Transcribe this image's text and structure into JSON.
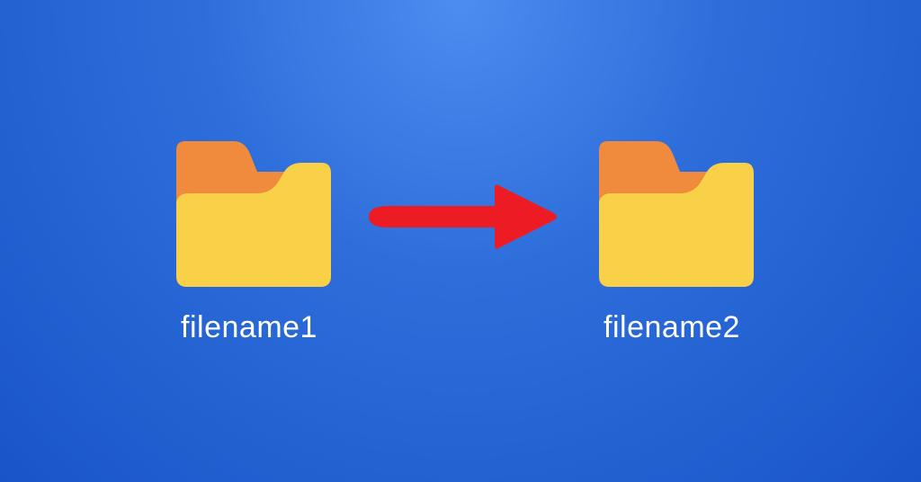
{
  "diagram": {
    "source": {
      "label": "filename1"
    },
    "target": {
      "label": "filename2"
    }
  },
  "colors": {
    "folder_back": "#f08a3c",
    "folder_front": "#f8d149",
    "arrow": "#ed1c24",
    "text": "#ffffff"
  }
}
